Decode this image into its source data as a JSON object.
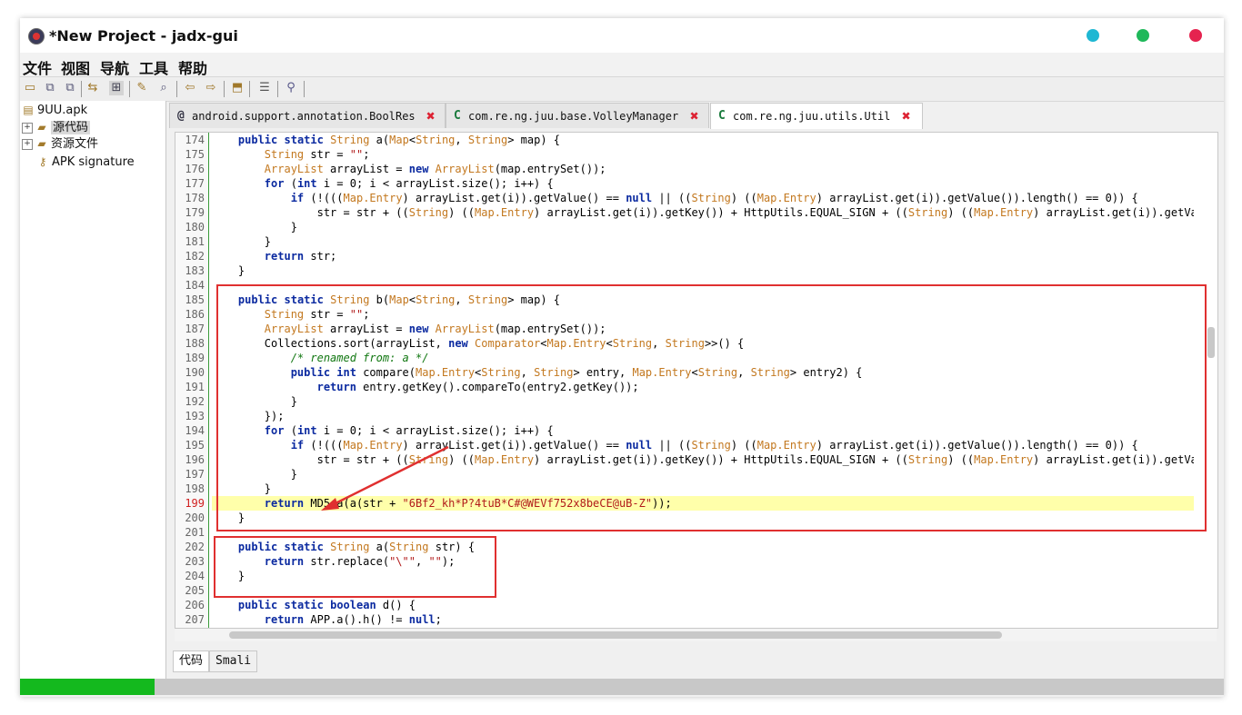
{
  "window": {
    "title": "*New Project - jadx-gui",
    "dots": [
      "#1fb7d3",
      "#1fb85a",
      "#e5234f"
    ]
  },
  "menu": [
    "文件",
    "视图",
    "导航",
    "工具",
    "帮助"
  ],
  "toolbar_icons": [
    "open-folder",
    "add-files",
    "save-all",
    "sync",
    "flatten",
    "decompile",
    "search",
    "back",
    "forward",
    "export",
    "log",
    "settings"
  ],
  "tree": {
    "root": "9UU.apk",
    "source": "源代码",
    "resources": "资源文件",
    "signature": "APK signature",
    "expander": "+"
  },
  "tabs": [
    {
      "icon": "@",
      "label": "android.support.annotation.BoolRes",
      "close": "✖"
    },
    {
      "icon": "C",
      "label": "com.re.ng.juu.base.VolleyManager",
      "close": "✖"
    },
    {
      "icon": "C",
      "label": "com.re.ng.juu.utils.Util",
      "close": "✖"
    }
  ],
  "code_lines": [
    {
      "n": "174",
      "text": "    public static String a(Map<String, String> map) {"
    },
    {
      "n": "175",
      "text": "        String str = \"\";"
    },
    {
      "n": "176",
      "text": "        ArrayList arrayList = new ArrayList(map.entrySet());"
    },
    {
      "n": "177",
      "text": "        for (int i = 0; i < arrayList.size(); i++) {"
    },
    {
      "n": "178",
      "text": "            if (!(((Map.Entry) arrayList.get(i)).getValue() == null || ((String) ((Map.Entry) arrayList.get(i)).getValue()).length() == 0)) {"
    },
    {
      "n": "179",
      "text": "                str = str + ((String) ((Map.Entry) arrayList.get(i)).getKey()) + HttpUtils.EQUAL_SIGN + ((String) ((Map.Entry) arrayList.get(i)).getValue()"
    },
    {
      "n": "180",
      "text": "            }"
    },
    {
      "n": "181",
      "text": "        }"
    },
    {
      "n": "182",
      "text": "        return str;"
    },
    {
      "n": "183",
      "text": "    }"
    },
    {
      "n": "184",
      "text": ""
    },
    {
      "n": "185",
      "text": "    public static String b(Map<String, String> map) {"
    },
    {
      "n": "186",
      "text": "        String str = \"\";"
    },
    {
      "n": "187",
      "text": "        ArrayList arrayList = new ArrayList(map.entrySet());"
    },
    {
      "n": "188",
      "text": "        Collections.sort(arrayList, new Comparator<Map.Entry<String, String>>() {"
    },
    {
      "n": "189",
      "text": "            /* renamed from: a */"
    },
    {
      "n": "190",
      "text": "            public int compare(Map.Entry<String, String> entry, Map.Entry<String, String> entry2) {"
    },
    {
      "n": "191",
      "text": "                return entry.getKey().compareTo(entry2.getKey());"
    },
    {
      "n": "192",
      "text": "            }"
    },
    {
      "n": "193",
      "text": "        });"
    },
    {
      "n": "194",
      "text": "        for (int i = 0; i < arrayList.size(); i++) {"
    },
    {
      "n": "195",
      "text": "            if (!(((Map.Entry) arrayList.get(i)).getValue() == null || ((String) ((Map.Entry) arrayList.get(i)).getValue()).length() == 0)) {"
    },
    {
      "n": "196",
      "text": "                str = str + ((String) ((Map.Entry) arrayList.get(i)).getKey()) + HttpUtils.EQUAL_SIGN + ((String) ((Map.Entry) arrayList.get(i)).getValue()"
    },
    {
      "n": "197",
      "text": "            }"
    },
    {
      "n": "198",
      "text": "        }"
    },
    {
      "n": "199",
      "text": "        return MD5.a(a(str + \"6Bf2_kh*P?4tuB*C#@WEVf752x8beCE@uB-Z\"));"
    },
    {
      "n": "200",
      "text": "    }"
    },
    {
      "n": "201",
      "text": ""
    },
    {
      "n": "202",
      "text": "    public static String a(String str) {"
    },
    {
      "n": "203",
      "text": "        return str.replace(\"\\\"\", \"\");"
    },
    {
      "n": "204",
      "text": "    }"
    },
    {
      "n": "205",
      "text": ""
    },
    {
      "n": "206",
      "text": "    public static boolean d() {"
    },
    {
      "n": "207",
      "text": "        return APP.a().h() != null;"
    }
  ],
  "highlight_line": "199",
  "bottom_tabs": [
    "代码",
    "Smali"
  ],
  "progress_fraction": 0.112,
  "accent": {
    "progress": "#14b91e",
    "annotation": "#e03030"
  }
}
